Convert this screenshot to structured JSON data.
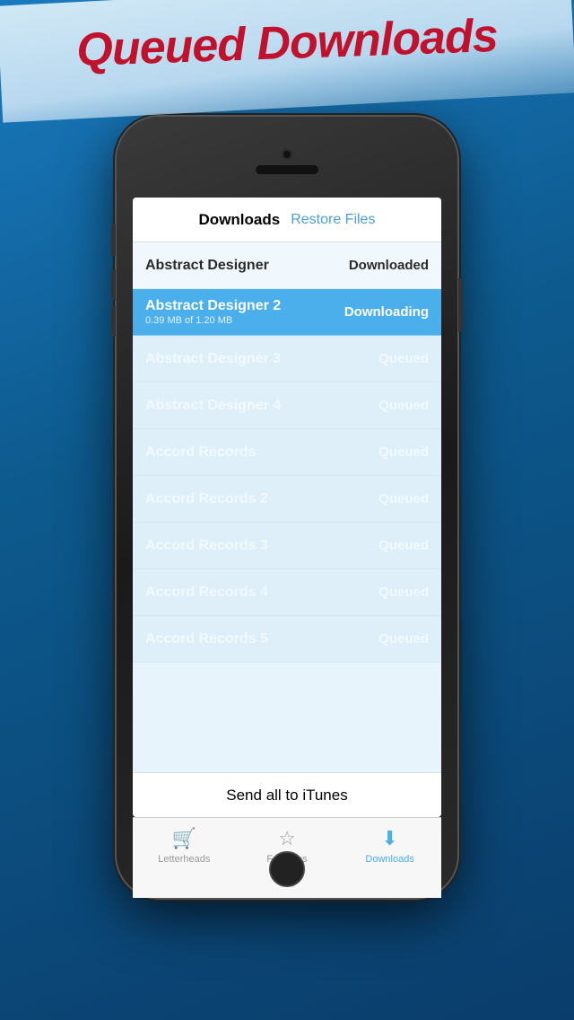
{
  "banner": {
    "text": "Queued Downloads"
  },
  "screen": {
    "header": {
      "title": "Downloads",
      "action": "Restore Files"
    },
    "rows": [
      {
        "name": "Abstract Designer",
        "sub": "",
        "status": "Downloaded",
        "state": "downloaded"
      },
      {
        "name": "Abstract Designer 2",
        "sub": "0.39 MB of 1.20 MB",
        "status": "Downloading",
        "state": "downloading"
      },
      {
        "name": "Abstract Designer 3",
        "sub": "",
        "status": "Queued",
        "state": "queued"
      },
      {
        "name": "Abstract Designer 4",
        "sub": "",
        "status": "Queued",
        "state": "queued"
      },
      {
        "name": "Accord Records",
        "sub": "",
        "status": "Queued",
        "state": "queued"
      },
      {
        "name": "Accord Records 2",
        "sub": "",
        "status": "Queued",
        "state": "queued"
      },
      {
        "name": "Accord Records 3",
        "sub": "",
        "status": "Queued",
        "state": "queued"
      },
      {
        "name": "Accord Records 4",
        "sub": "",
        "status": "Queued",
        "state": "queued"
      },
      {
        "name": "Accord Records 5",
        "sub": "",
        "status": "Queued",
        "state": "queued"
      }
    ],
    "send_button": "Send all to iTunes"
  },
  "tabs": [
    {
      "label": "Letterheads",
      "icon": "🛒",
      "active": false
    },
    {
      "label": "Favorites",
      "icon": "☆",
      "active": false
    },
    {
      "label": "Downloads",
      "icon": "⬇",
      "active": true
    }
  ]
}
